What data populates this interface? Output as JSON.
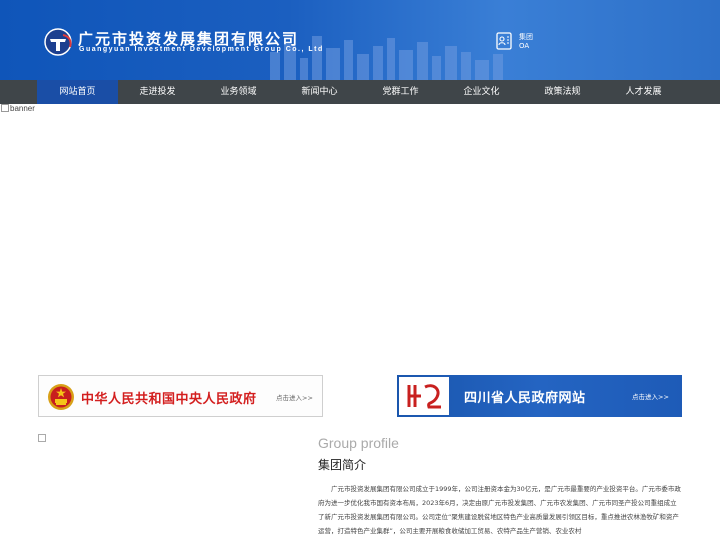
{
  "header": {
    "company_cn": "广元市投资发展集团有限公司",
    "company_en": "Guangyuan Investment Development Group Co., Ltd",
    "oa_line1": "集团",
    "oa_line2": "OA",
    "oa_icon": "document-person-icon",
    "logo_icon": "company-emblem-icon",
    "colors": {
      "header_blue": "#1b5fc0",
      "nav_dark": "#3f4549",
      "nav_active": "#1a4ea6"
    }
  },
  "nav": {
    "items": [
      {
        "label": "网站首页",
        "active": true
      },
      {
        "label": "走进投发"
      },
      {
        "label": "业务领域"
      },
      {
        "label": "新闻中心"
      },
      {
        "label": "党群工作"
      },
      {
        "label": "企业文化"
      },
      {
        "label": "政策法规"
      },
      {
        "label": "人才发展"
      }
    ]
  },
  "banner": {
    "alt": "banner"
  },
  "gov_links": {
    "central": {
      "title": "中华人民共和国中央人民政府",
      "enter": "点击进入>>",
      "icon": "national-emblem-icon"
    },
    "sichuan": {
      "title": "四川省人民政府网站",
      "enter": "点击进入>>",
      "icon": "sichuan-seal-icon"
    }
  },
  "profile": {
    "title_en": "Group profile",
    "title_cn": "集团简介",
    "text": "广元市投资发展集团有限公司成立于1999年，公司注册资本金为30亿元，是广元市最重要的产业投资平台。广元市委市政府为进一步优化我市国有资本布局，2023年6月，决定由原广元市投发集团、广元市农发集团、广元市同圣产投公司重组成立了新广元市投资发展集团有限公司。公司定位“聚焦建设脱贫地区特色产业高质量发展引领区目标，重点推进农林渔牧矿和资产运营，打造特色产业集群”，公司主要开展粮食收储加工贸易、农特产品生产营销、农业农村"
  }
}
